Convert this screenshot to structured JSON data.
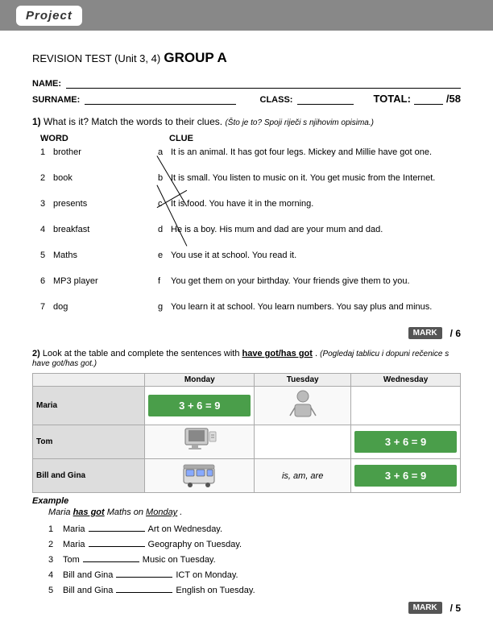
{
  "header": {
    "label": "Project"
  },
  "title": {
    "prefix": "REVISION TEST (Unit 3, 4)",
    "group": "GROUP A"
  },
  "form": {
    "name_label": "NAME:",
    "surname_label": "SURNAME:",
    "class_label": "CLASS:",
    "total_label": "TOTAL:",
    "total_denom": "/58"
  },
  "section1": {
    "number": "1)",
    "instruction": "What is it? Match the words to their clues.",
    "instruction_native": "(Što je to? Spoji riječi s njihovim opisima.)",
    "col_word": "WORD",
    "col_clue": "CLUE",
    "words": [
      {
        "num": "1",
        "word": "brother"
      },
      {
        "num": "2",
        "word": "book"
      },
      {
        "num": "3",
        "word": "presents"
      },
      {
        "num": "4",
        "word": "breakfast"
      },
      {
        "num": "5",
        "word": "Maths"
      },
      {
        "num": "6",
        "word": "MP3 player"
      },
      {
        "num": "7",
        "word": "dog"
      }
    ],
    "clues": [
      {
        "letter": "a",
        "text": "It is an animal. It has got four legs. Mickey and Millie have got one."
      },
      {
        "letter": "b",
        "text": "It is small. You listen to music on it. You get music from the Internet."
      },
      {
        "letter": "c",
        "text": "It is food. You have it in the morning."
      },
      {
        "letter": "d",
        "text": "He is a boy. His mum and dad are your mum and dad."
      },
      {
        "letter": "e",
        "text": "You use it at school. You read it."
      },
      {
        "letter": "f",
        "text": "You get them on your birthday. Your friends give them to you."
      },
      {
        "letter": "g",
        "text": "You learn it at school. You learn numbers. You say plus and minus."
      }
    ],
    "mark_label": "MARK",
    "mark_value": "/ 6"
  },
  "section2": {
    "number": "2)",
    "instruction": "Look at the table and complete the sentences with",
    "have_got": "have got/has got",
    "instruction_native": "(Pogledaj tablicu i dopuni rečenice s have got/has got.)",
    "table": {
      "headers": [
        "",
        "Monday",
        "Tuesday",
        "Wednesday"
      ],
      "rows": [
        {
          "name": "Maria",
          "monday": "math_eq",
          "tuesday": "person_img",
          "wednesday": ""
        },
        {
          "name": "Tom",
          "monday": "computer_img",
          "tuesday": "",
          "wednesday": "math_eq"
        },
        {
          "name": "Bill and Gina",
          "monday": "bus_img",
          "tuesday": "is_am_are",
          "wednesday": "math_eq"
        }
      ]
    },
    "example_label": "Example",
    "example_text": "Maria",
    "example_verb": "has got",
    "example_subject": "Maths",
    "example_prep": "on",
    "example_day": "Monday",
    "sentences": [
      {
        "num": "1",
        "text": "Maria",
        "blank_after": true,
        "rest": "Art on Wednesday."
      },
      {
        "num": "2",
        "text": "Maria",
        "blank_after": true,
        "rest": "Geography on Tuesday."
      },
      {
        "num": "3",
        "text": "Tom",
        "blank_after": true,
        "rest": "Music on Tuesday."
      },
      {
        "num": "4",
        "text": "Bill and Gina",
        "blank_after": true,
        "rest": "ICT on Monday."
      },
      {
        "num": "5",
        "text": "Bill and Gina",
        "blank_after": true,
        "rest": "English on Tuesday."
      }
    ],
    "mark_label": "MARK",
    "mark_value": "/ 5"
  }
}
